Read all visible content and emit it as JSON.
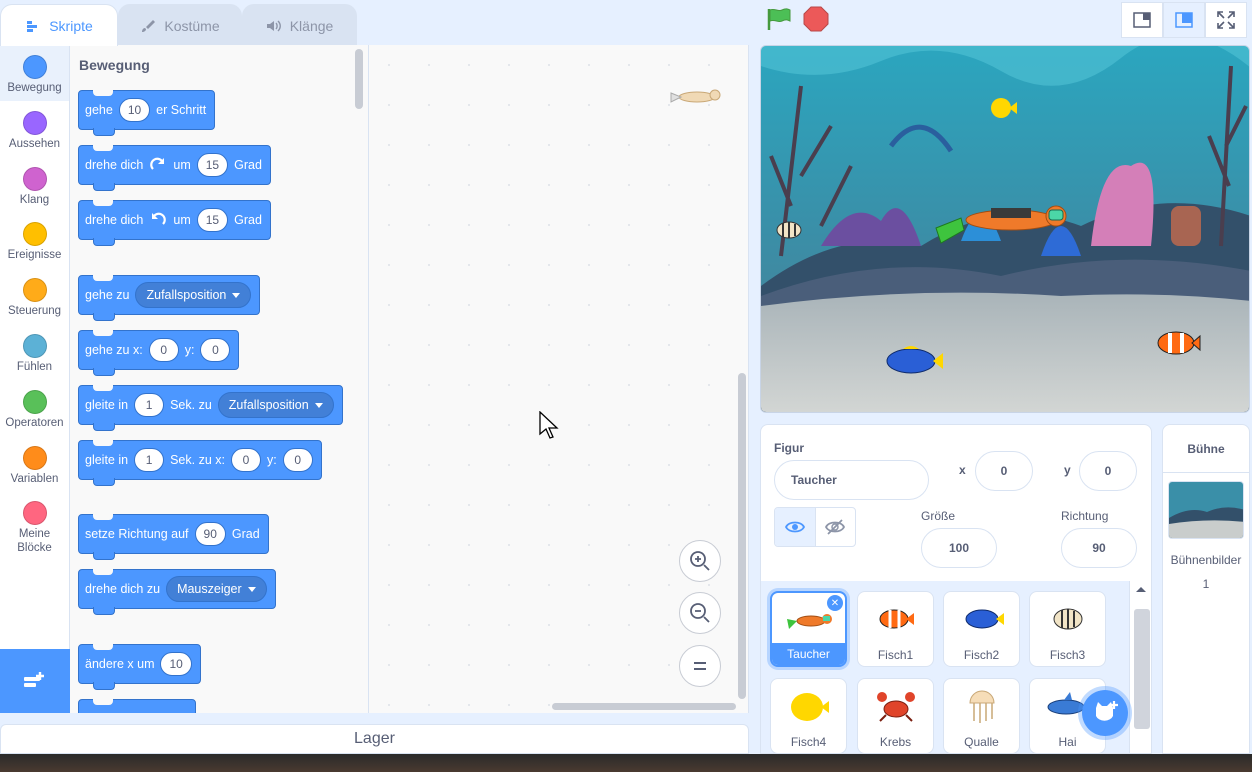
{
  "tabs": [
    {
      "label": "Skripte",
      "active": true
    },
    {
      "label": "Kostüme",
      "active": false
    },
    {
      "label": "Klänge",
      "active": false
    }
  ],
  "categories": [
    {
      "label": "Bewegung",
      "color": "#4c97ff"
    },
    {
      "label": "Aussehen",
      "color": "#9966ff"
    },
    {
      "label": "Klang",
      "color": "#cf63cf"
    },
    {
      "label": "Ereignisse",
      "color": "#ffbf00"
    },
    {
      "label": "Steuerung",
      "color": "#ffab19"
    },
    {
      "label": "Fühlen",
      "color": "#5cb1d6"
    },
    {
      "label": "Operatoren",
      "color": "#59c059"
    },
    {
      "label": "Variablen",
      "color": "#ff8c1a"
    },
    {
      "label": "Meine Blöcke",
      "color": "#ff6680"
    }
  ],
  "palette": {
    "title": "Bewegung",
    "blocks": {
      "move": {
        "pre": "gehe",
        "val": "10",
        "post": "er Schritt"
      },
      "turn_right": {
        "pre": "drehe dich",
        "mid": "um",
        "val": "15",
        "post": "Grad"
      },
      "turn_left": {
        "pre": "drehe dich",
        "mid": "um",
        "val": "15",
        "post": "Grad"
      },
      "goto": {
        "pre": "gehe zu",
        "drop": "Zufallsposition"
      },
      "goto_xy": {
        "pre": "gehe zu x:",
        "x": "0",
        "ylabel": "y:",
        "y": "0"
      },
      "glide": {
        "pre": "gleite in",
        "val": "1",
        "mid": "Sek. zu",
        "drop": "Zufallsposition"
      },
      "glide_xy": {
        "pre": "gleite in",
        "val": "1",
        "mid": "Sek. zu x:",
        "x": "0",
        "ylabel": "y:",
        "y": "0"
      },
      "point_dir": {
        "pre": "setze Richtung auf",
        "val": "90",
        "post": "Grad"
      },
      "point_towards": {
        "pre": "drehe dich zu",
        "drop": "Mauszeiger"
      },
      "change_x": {
        "pre": "ändere x um",
        "val": "10"
      }
    }
  },
  "lager": "Lager",
  "sprite_info": {
    "figur_label": "Figur",
    "name": "Taucher",
    "x_label": "x",
    "x": "0",
    "y_label": "y",
    "y": "0",
    "size_label": "Größe",
    "size": "100",
    "direction_label": "Richtung",
    "direction": "90"
  },
  "sprites": [
    {
      "name": "Taucher",
      "selected": true,
      "icon": "diver-icon"
    },
    {
      "name": "Fisch1",
      "selected": false,
      "icon": "clownfish-icon"
    },
    {
      "name": "Fisch2",
      "selected": false,
      "icon": "bluefish-icon"
    },
    {
      "name": "Fisch3",
      "selected": false,
      "icon": "angelfish-icon"
    },
    {
      "name": "Fisch4",
      "selected": false,
      "icon": "yellowfish-icon"
    },
    {
      "name": "Krebs",
      "selected": false,
      "icon": "crab-icon"
    },
    {
      "name": "Qualle",
      "selected": false,
      "icon": "jellyfish-icon"
    },
    {
      "name": "Hai",
      "selected": false,
      "icon": "shark-icon"
    }
  ],
  "stage_pane": {
    "title": "Bühne",
    "backdrops_label": "Bühnenbilder",
    "backdrops_count": "1"
  },
  "colors": {
    "accent": "#4c97ff",
    "motion_block": "#4c97ff",
    "flag": "#4cbf56",
    "stop": "#ec5959"
  }
}
